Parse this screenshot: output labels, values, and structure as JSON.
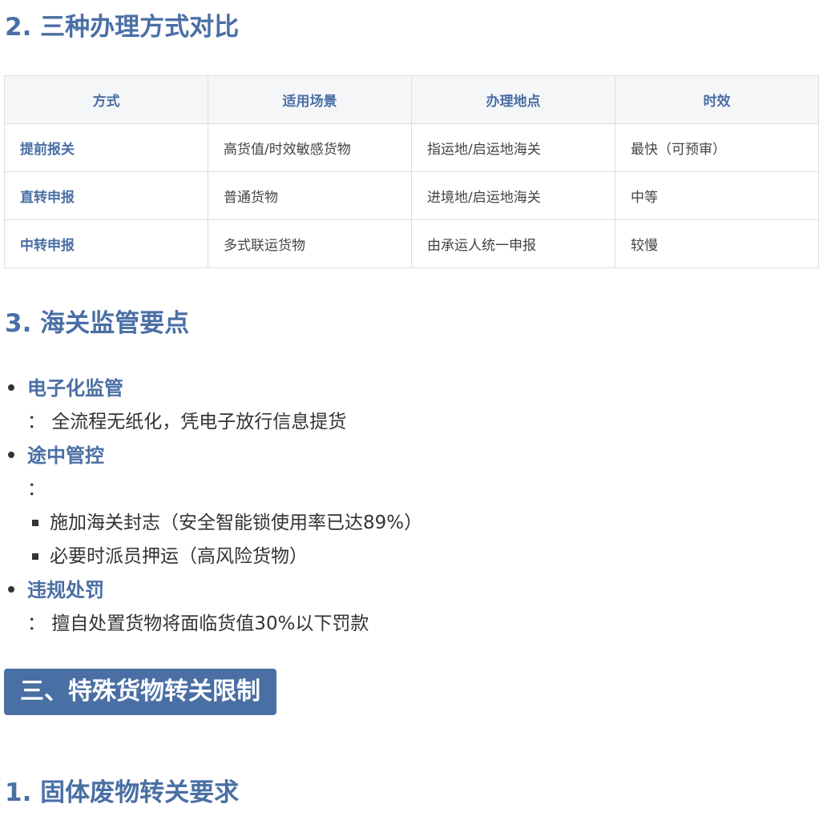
{
  "section_comparison": {
    "title": "2. 三种办理方式对比",
    "table": {
      "headers": [
        "方式",
        "适用场景",
        "办理地点",
        "时效"
      ],
      "rows": [
        [
          "提前报关",
          "高货值/时效敏感货物",
          "指运地/启运地海关",
          "最快（可预审）"
        ],
        [
          "直转申报",
          "普通货物",
          "进境地/启运地海关",
          "中等"
        ],
        [
          "中转申报",
          "多式联运货物",
          "由承运人统一申报",
          "较慢"
        ]
      ]
    }
  },
  "section_supervision": {
    "title": "3. 海关监管要点",
    "items": [
      {
        "title": "电子化监管",
        "desc": "： 全流程无纸化，凭电子放行信息提货"
      },
      {
        "title": "途中管控",
        "desc": "：",
        "sub": [
          "施加海关封志（安全智能锁使用率已达89%）",
          "必要时派员押运（高风险货物）"
        ]
      },
      {
        "title": "违规处罚",
        "desc": "： 擅自处置货物将面临货值30%以下罚款"
      }
    ]
  },
  "banner": {
    "title": "三、特殊货物转关限制"
  },
  "section_solid_waste": {
    "title": "1. 固体废物转关要求"
  }
}
